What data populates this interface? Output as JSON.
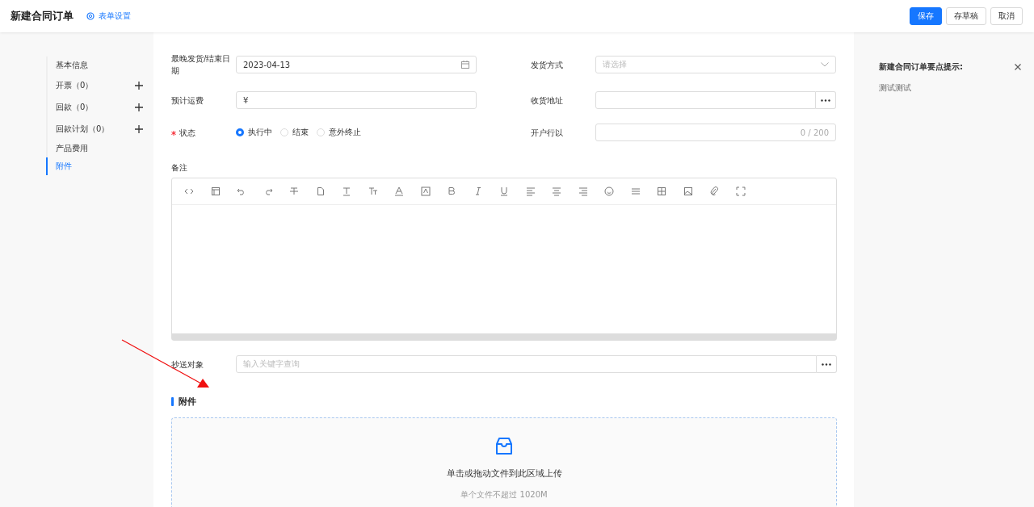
{
  "header": {
    "title": "新建合同订单",
    "settings_link": "表单设置",
    "buttons": [
      {
        "label": "保存",
        "kind": "primary"
      },
      {
        "label": "存草稿",
        "kind": "default"
      },
      {
        "label": "取消",
        "kind": "default"
      }
    ]
  },
  "nav": {
    "items": [
      {
        "label": "基本信息",
        "addable": false,
        "selected": false
      },
      {
        "label": "开票",
        "count": "（0）",
        "addable": true,
        "selected": false
      },
      {
        "label": "回款",
        "count": "（0）",
        "addable": true,
        "selected": false
      },
      {
        "label": "回款计划",
        "count": "（0）",
        "addable": true,
        "selected": false
      },
      {
        "label": "产品费用",
        "addable": false,
        "selected": false
      },
      {
        "label": "附件",
        "addable": false,
        "selected": true
      }
    ]
  },
  "form": {
    "rows": [
      [
        {
          "label": "最晚发货/结束日期",
          "required": false,
          "kind": "date",
          "value": "2023-04-13"
        },
        {
          "label": "发货方式",
          "required": false,
          "kind": "select",
          "placeholder": "请选择"
        }
      ],
      [
        {
          "label": "预计运费",
          "required": false,
          "kind": "text",
          "value": "¥"
        },
        {
          "label": "收货地址",
          "required": false,
          "kind": "picker"
        }
      ],
      [
        {
          "label": "状态",
          "required": true,
          "kind": "radio",
          "options": [
            {
              "label": "执行中",
              "selected": true
            },
            {
              "label": "结束",
              "selected": false
            },
            {
              "label": "意外终止",
              "selected": false
            }
          ]
        },
        {
          "label": "开户行以",
          "required": false,
          "kind": "counter",
          "counter": "0 / 200"
        }
      ]
    ],
    "remarks": {
      "label": "备注"
    },
    "cc": {
      "label": "抄送对象",
      "placeholder": "输入关键字查询"
    },
    "attachments": {
      "title": "附件",
      "hint": "单击或拖动文件到此区域上传",
      "limit": "单个文件不超过 1020M"
    }
  },
  "tips": {
    "title": "新建合同订单要点提示:",
    "body": "测试测试"
  }
}
